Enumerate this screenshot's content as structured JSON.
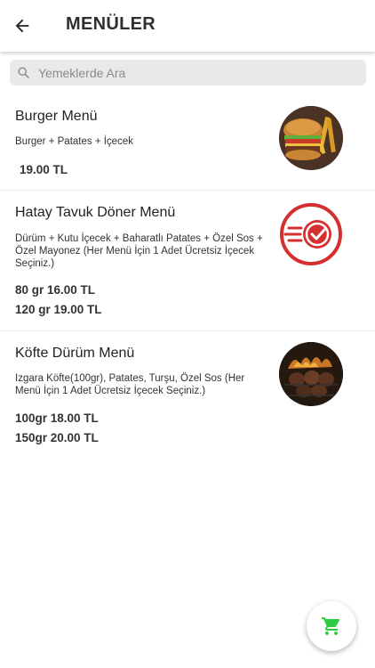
{
  "header": {
    "title": "MENÜLER",
    "back_icon": "arrow-left-icon"
  },
  "search": {
    "placeholder": "Yemeklerde Ara",
    "icon": "search-icon"
  },
  "menus": [
    {
      "name": "Burger Menü",
      "description": "Burger + Patates + İçecek",
      "prices": [
        "19.00 TL"
      ],
      "image": "burger-fries-image"
    },
    {
      "name": "Hatay Tavuk Döner Menü",
      "description": "Dürüm + Kutu İçecek + Baharatlı Patates + Özel Sos + Özel Mayonez (Her Menü İçin 1 Adet Ücretsiz İçecek Seçiniz.)",
      "prices": [
        "80 gr  16.00 TL",
        "120 gr  19.00 TL"
      ],
      "image": "fast-delivery-logo"
    },
    {
      "name": "Köfte Dürüm Menü",
      "description": "Izgara Köfte(100gr), Patates, Turşu, Özel Sos (Her Menü İçin 1 Adet Ücretsiz İçecek Seçiniz.)",
      "prices": [
        "100gr  18.00 TL",
        "150gr  20.00 TL"
      ],
      "image": "grilled-meatballs-image"
    }
  ],
  "cart": {
    "icon": "shopping-cart-icon",
    "color": "#2ecc40"
  },
  "colors": {
    "accent_red": "#d62f2f",
    "cart_green": "#2ecc40"
  }
}
